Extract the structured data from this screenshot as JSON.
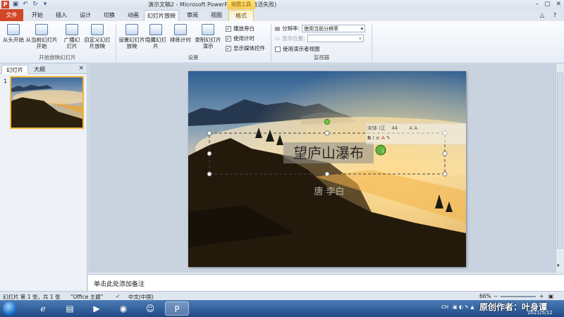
{
  "window": {
    "title": "演示文稿2 - Microsoft PowerPoint(产品激活失败)",
    "context_group": "绘图工具",
    "logo": "P"
  },
  "qat_icons": [
    "save-icon",
    "undo-icon",
    "redo-icon",
    "customize-icon"
  ],
  "tabs": {
    "file": "文件",
    "items": [
      "开始",
      "插入",
      "设计",
      "切换",
      "动画",
      "幻灯片放映",
      "审阅",
      "视图",
      "格式"
    ],
    "active": "幻灯片放映"
  },
  "ribbon": {
    "group1": {
      "from_start": "从头开始",
      "from_current": "从当前幻灯片开始",
      "broadcast": "广播幻灯片",
      "custom": "自定义幻灯片放映",
      "label": "开始放映幻灯片"
    },
    "group2": {
      "setup": "设置幻灯片放映",
      "hide": "隐藏幻灯片",
      "rehearse": "排练计时",
      "record": "录制幻灯片演示",
      "play_narration": "播放旁白",
      "use_timings": "使用计时",
      "show_media": "显示媒体控件",
      "label": "设置"
    },
    "group3": {
      "resolution_label": "分辨率:",
      "resolution_value": "使用当前分辨率",
      "display_on_label": "显示位置:",
      "presenter_view": "使用演示者视图",
      "label": "监视器"
    }
  },
  "panel": {
    "tab_slides": "幻灯片",
    "tab_outline": "大纲",
    "close": "×",
    "slide_number": "1"
  },
  "slide": {
    "title": "望庐山瀑布",
    "subtitle": "唐 李白",
    "mini_toolbar_font": "宋体 (正",
    "mini_toolbar_size": "44"
  },
  "notes_placeholder": "单击此处添加备注",
  "status": {
    "slide_info": "幻灯片 第 1 张，共 1 张",
    "theme": "\"Office 主题\"",
    "language": "中文(中国)",
    "zoom": "66%"
  },
  "taskbar": {
    "ime": "CH",
    "watermark": "原创作者：叶身谭",
    "date": "2021/5/12"
  },
  "colors": {
    "file_tab": "#d24726",
    "context_tab": "#f8c84a",
    "selection": "#f2b53a"
  }
}
